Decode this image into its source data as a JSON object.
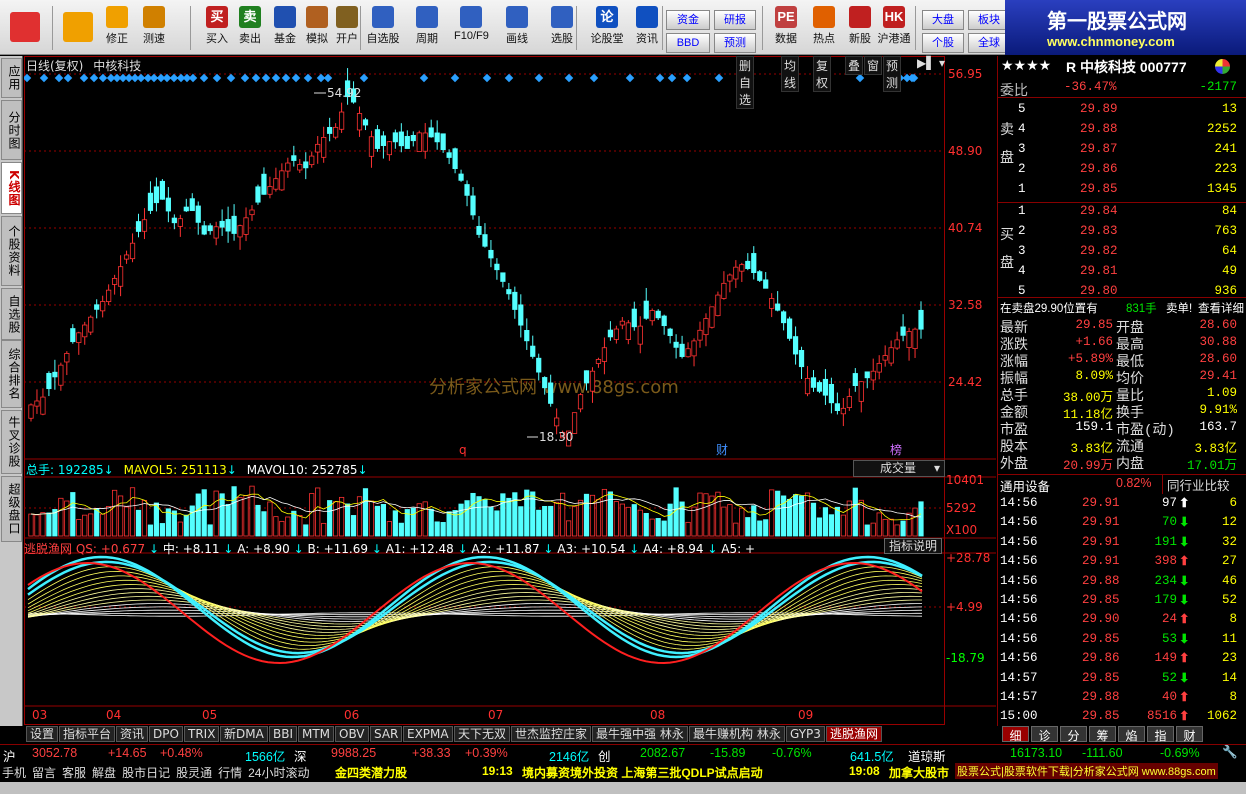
{
  "toolbar": {
    "buttons": [
      {
        "label": "",
        "icon": "windows-icon"
      },
      {
        "label": "",
        "icon": "back-arrow-icon"
      },
      {
        "label": "修正",
        "icon": "up-down-arrows-icon"
      },
      {
        "label": "测速",
        "icon": "speed-dial-icon"
      },
      {
        "label": "买入",
        "icon": "buy-icon",
        "glyph": "买"
      },
      {
        "label": "卖出",
        "icon": "sell-icon",
        "glyph": "卖"
      },
      {
        "label": "基金",
        "icon": "fund-icon"
      },
      {
        "label": "模拟",
        "icon": "hammer-icon"
      },
      {
        "label": "开户",
        "icon": "lock-icon"
      },
      {
        "label": "自选股",
        "icon": "star-icon"
      },
      {
        "label": "周期",
        "icon": "clock-icon"
      },
      {
        "label": "F10/F9",
        "icon": "document-icon"
      },
      {
        "label": "画线",
        "icon": "pencil-icon"
      },
      {
        "label": "选股",
        "icon": "monitor-icon"
      },
      {
        "label": "论股堂",
        "icon": "forum-icon",
        "glyph": "论"
      },
      {
        "label": "资讯",
        "icon": "news-icon"
      }
    ],
    "small_buttons": [
      "资金",
      "BBD",
      "研报",
      "预测"
    ],
    "buttons2": [
      {
        "label": "数据",
        "icon": "pe-icon",
        "glyph": "PE"
      },
      {
        "label": "热点",
        "icon": "hot-icon"
      },
      {
        "label": "新股",
        "icon": "new-stock-icon"
      },
      {
        "label": "沪港通",
        "icon": "hk-connect-icon",
        "glyph": "HK"
      }
    ],
    "right_buttons": [
      "大盘",
      "板块",
      "个股",
      "全球"
    ]
  },
  "logo": {
    "title": "第一股票公式网",
    "url": "www.chnmoney.com"
  },
  "sidebar": [
    "应用",
    "分时图",
    "K线图",
    "个股资料",
    "自选股",
    "综合排名",
    "牛叉诊股",
    "超级盘口"
  ],
  "chart": {
    "title": "日线(复权)",
    "stock": "中核科技",
    "header_buttons": [
      "删自选",
      "均线",
      "复权",
      "叠",
      "窗",
      "预测"
    ],
    "price_labels": [
      "56.95",
      "48.90",
      "40.74",
      "32.58",
      "24.42"
    ],
    "price_high": "54.92",
    "price_low": "18.30",
    "watermark": "分析家公式网  www.88gs.com",
    "markers": [
      "q",
      "财",
      "榜"
    ],
    "vol_header": {
      "zongshou": "总手: 192285",
      "mavol5": "MAVOL5: 251113",
      "mavol10": "MAVOL10: 252785"
    },
    "vol_dropdown": "成交量",
    "vol_labels": [
      "10401",
      "5292",
      "X100"
    ],
    "ind_header": {
      "name": "逃脱渔网",
      "qs": "QS: +0.677",
      "zhong": "中: +8.11",
      "a": "A: +8.90",
      "b": "B: +11.69",
      "a1": "A1: +12.48",
      "a2": "A2: +11.87",
      "a3": "A3: +10.54",
      "a4": "A4: +8.94",
      "a5": "A5: +"
    },
    "ind_button": "指标说明",
    "ind_labels": [
      "+28.78",
      "+4.99",
      "-18.79"
    ],
    "months": [
      "03",
      "04",
      "05",
      "06",
      "07",
      "08",
      "09"
    ]
  },
  "chart_data": {
    "type": "candlestick",
    "title": "日线(复权) 中核科技",
    "ylim": [
      16,
      58
    ],
    "x_months": [
      "03",
      "04",
      "05",
      "06",
      "07",
      "08",
      "09"
    ],
    "price_points": [
      [
        0,
        22
      ],
      [
        6,
        23
      ],
      [
        12,
        26
      ],
      [
        18,
        29
      ],
      [
        24,
        31
      ],
      [
        30,
        33
      ],
      [
        36,
        36
      ],
      [
        42,
        39
      ],
      [
        48,
        42
      ],
      [
        54,
        44
      ],
      [
        60,
        41
      ],
      [
        66,
        43
      ],
      [
        72,
        40
      ],
      [
        78,
        41
      ],
      [
        84,
        40
      ],
      [
        90,
        42
      ],
      [
        96,
        44
      ],
      [
        102,
        46
      ],
      [
        108,
        48
      ],
      [
        114,
        47
      ],
      [
        120,
        50
      ],
      [
        126,
        51
      ],
      [
        132,
        54.92
      ],
      [
        138,
        52
      ],
      [
        144,
        49
      ],
      [
        150,
        50
      ],
      [
        156,
        49
      ],
      [
        162,
        51
      ],
      [
        168,
        50
      ],
      [
        174,
        48
      ],
      [
        180,
        45
      ],
      [
        186,
        40
      ],
      [
        192,
        37
      ],
      [
        198,
        34
      ],
      [
        204,
        30
      ],
      [
        210,
        26
      ],
      [
        216,
        22
      ],
      [
        222,
        18.3
      ],
      [
        228,
        23
      ],
      [
        234,
        26
      ],
      [
        240,
        29
      ],
      [
        246,
        31
      ],
      [
        252,
        30
      ],
      [
        258,
        32
      ],
      [
        264,
        30
      ],
      [
        270,
        27
      ],
      [
        276,
        29
      ],
      [
        282,
        32
      ],
      [
        288,
        35
      ],
      [
        294,
        37
      ],
      [
        300,
        36
      ],
      [
        306,
        34
      ],
      [
        312,
        31
      ],
      [
        318,
        27
      ],
      [
        324,
        24
      ],
      [
        330,
        23
      ],
      [
        336,
        21
      ],
      [
        342,
        24
      ],
      [
        348,
        25
      ],
      [
        354,
        27
      ],
      [
        360,
        29
      ],
      [
        366,
        30
      ],
      [
        372,
        30
      ]
    ],
    "volume_ylim": [
      0,
      10401
    ],
    "indicator": {
      "name": "逃脱渔网",
      "ylim": [
        -18.79,
        28.78
      ],
      "QS": 0.677,
      "中": 8.11,
      "A": 8.9,
      "B": 11.69,
      "A1": 12.48,
      "A2": 11.87,
      "A3": 10.54,
      "A4": 8.94
    }
  },
  "quote": {
    "stars": "★★★★",
    "code_name": "R 中核科技 000777",
    "weibi_label": "委比",
    "weibi": "-36.47%",
    "weicha": "-2177",
    "sell_label": "卖盘",
    "buy_label": "买盘",
    "sell": [
      {
        "lvl": "5",
        "price": "29.89",
        "vol": "13"
      },
      {
        "lvl": "4",
        "price": "29.88",
        "vol": "2252"
      },
      {
        "lvl": "3",
        "price": "29.87",
        "vol": "241"
      },
      {
        "lvl": "2",
        "price": "29.86",
        "vol": "223"
      },
      {
        "lvl": "1",
        "price": "29.85",
        "vol": "1345"
      }
    ],
    "buy": [
      {
        "lvl": "1",
        "price": "29.84",
        "vol": "84"
      },
      {
        "lvl": "2",
        "price": "29.83",
        "vol": "763"
      },
      {
        "lvl": "3",
        "price": "29.82",
        "vol": "64"
      },
      {
        "lvl": "4",
        "price": "29.81",
        "vol": "49"
      },
      {
        "lvl": "5",
        "price": "29.80",
        "vol": "936"
      }
    ],
    "notice": "在卖盘29.90位置有",
    "notice_vol": "831手",
    "notice_act": "卖单!",
    "notice_link": "查看详细",
    "stats": [
      {
        "l1": "最新",
        "v1": "29.85",
        "l2": "开盘",
        "v2": "28.60",
        "c1": "up",
        "c2": "up"
      },
      {
        "l1": "涨跌",
        "v1": "+1.66",
        "l2": "最高",
        "v2": "30.88",
        "c1": "up",
        "c2": "up"
      },
      {
        "l1": "涨幅",
        "v1": "+5.89%",
        "l2": "最低",
        "v2": "28.60",
        "c1": "up",
        "c2": "up"
      },
      {
        "l1": "振幅",
        "v1": "8.09%",
        "l2": "均价",
        "v2": "29.41",
        "c1": "yl",
        "c2": "up"
      },
      {
        "l1": "总手",
        "v1": "38.00万",
        "l2": "量比",
        "v2": "1.09",
        "c1": "yl",
        "c2": "yl"
      },
      {
        "l1": "金额",
        "v1": "11.18亿",
        "l2": "换手",
        "v2": "9.91%",
        "c1": "yl",
        "c2": "yl"
      },
      {
        "l1": "市盈",
        "v1": "159.1",
        "l2": "市盈(动)",
        "v2": "163.7",
        "c1": "wt",
        "c2": "wt"
      },
      {
        "l1": "股本",
        "v1": "3.83亿",
        "l2": "流通",
        "v2": "3.83亿",
        "c1": "yl",
        "c2": "yl"
      },
      {
        "l1": "外盘",
        "v1": "20.99万",
        "l2": "内盘",
        "v2": "17.01万",
        "c1": "up",
        "c2": "dn"
      }
    ],
    "industry": "通用设备",
    "industry_pct": "0.82%",
    "industry_btn": "同行业比较",
    "ticks": [
      {
        "t": "14:56",
        "p": "29.91",
        "v": "97",
        "d": "wt",
        "n": "6"
      },
      {
        "t": "14:56",
        "p": "29.91",
        "v": "70",
        "d": "dn",
        "n": "12"
      },
      {
        "t": "14:56",
        "p": "29.91",
        "v": "191",
        "d": "dn",
        "n": "32"
      },
      {
        "t": "14:56",
        "p": "29.91",
        "v": "398",
        "d": "up",
        "n": "27"
      },
      {
        "t": "14:56",
        "p": "29.88",
        "v": "234",
        "d": "dn",
        "n": "46"
      },
      {
        "t": "14:56",
        "p": "29.85",
        "v": "179",
        "d": "dn",
        "n": "52"
      },
      {
        "t": "14:56",
        "p": "29.90",
        "v": "24",
        "d": "up",
        "n": "8"
      },
      {
        "t": "14:56",
        "p": "29.85",
        "v": "53",
        "d": "dn",
        "n": "11"
      },
      {
        "t": "14:56",
        "p": "29.86",
        "v": "149",
        "d": "up",
        "n": "23"
      },
      {
        "t": "14:57",
        "p": "29.85",
        "v": "52",
        "d": "dn",
        "n": "14"
      },
      {
        "t": "14:57",
        "p": "29.88",
        "v": "40",
        "d": "up",
        "n": "8"
      },
      {
        "t": "15:00",
        "p": "29.85",
        "v": "8516",
        "d": "up",
        "n": "1062"
      }
    ],
    "tabs": [
      "细",
      "诊",
      "分",
      "筹",
      "焰",
      "指",
      "财"
    ]
  },
  "bottom_tabs": [
    "设置",
    "指标平台",
    "资讯",
    "DPO",
    "TRIX",
    "新DMA",
    "BBI",
    "MTM",
    "OBV",
    "SAR",
    "EXPMA",
    "天下无双",
    "世杰监控庄家",
    "最牛强中强 林永",
    "最牛赚机构 林永",
    "GYP3",
    "逃脱渔网"
  ],
  "index_bar": {
    "sh": "沪",
    "sh_val": "3052.78",
    "sh_chg": "+14.65",
    "sh_pct": "+0.48%",
    "sh_amt": "1566亿",
    "sz": "深",
    "sz_val": "9988.25",
    "sz_chg": "+38.33",
    "sz_pct": "+0.39%",
    "sz_amt": "2146亿",
    "cy": "创",
    "cy_val": "2082.67",
    "cy_chg": "-15.89",
    "cy_pct": "-0.76%",
    "cy_amt": "641.5亿",
    "dj": "道琼斯",
    "dj_val": "16173.10",
    "dj_chg": "-111.60",
    "dj_pct": "-0.69%"
  },
  "news_bar": {
    "items": [
      "手机",
      "留言",
      "客服",
      "解盘",
      "股市日记",
      "股灵通",
      "行情",
      "24小时滚动"
    ],
    "n1": "金四类潜力股",
    "t2": "19:13",
    "n2": "境内募资境外投资 上海第三批QDLP试点启动",
    "t3": "19:08",
    "n3": "加拿大股市",
    "n4": "股票公式|股票软件下载|分析家公式网 www.88gs.com"
  },
  "colors": {
    "up": "#ff3232",
    "down": "#54ffff",
    "grid": "#800000",
    "accent": "#ffff00"
  }
}
